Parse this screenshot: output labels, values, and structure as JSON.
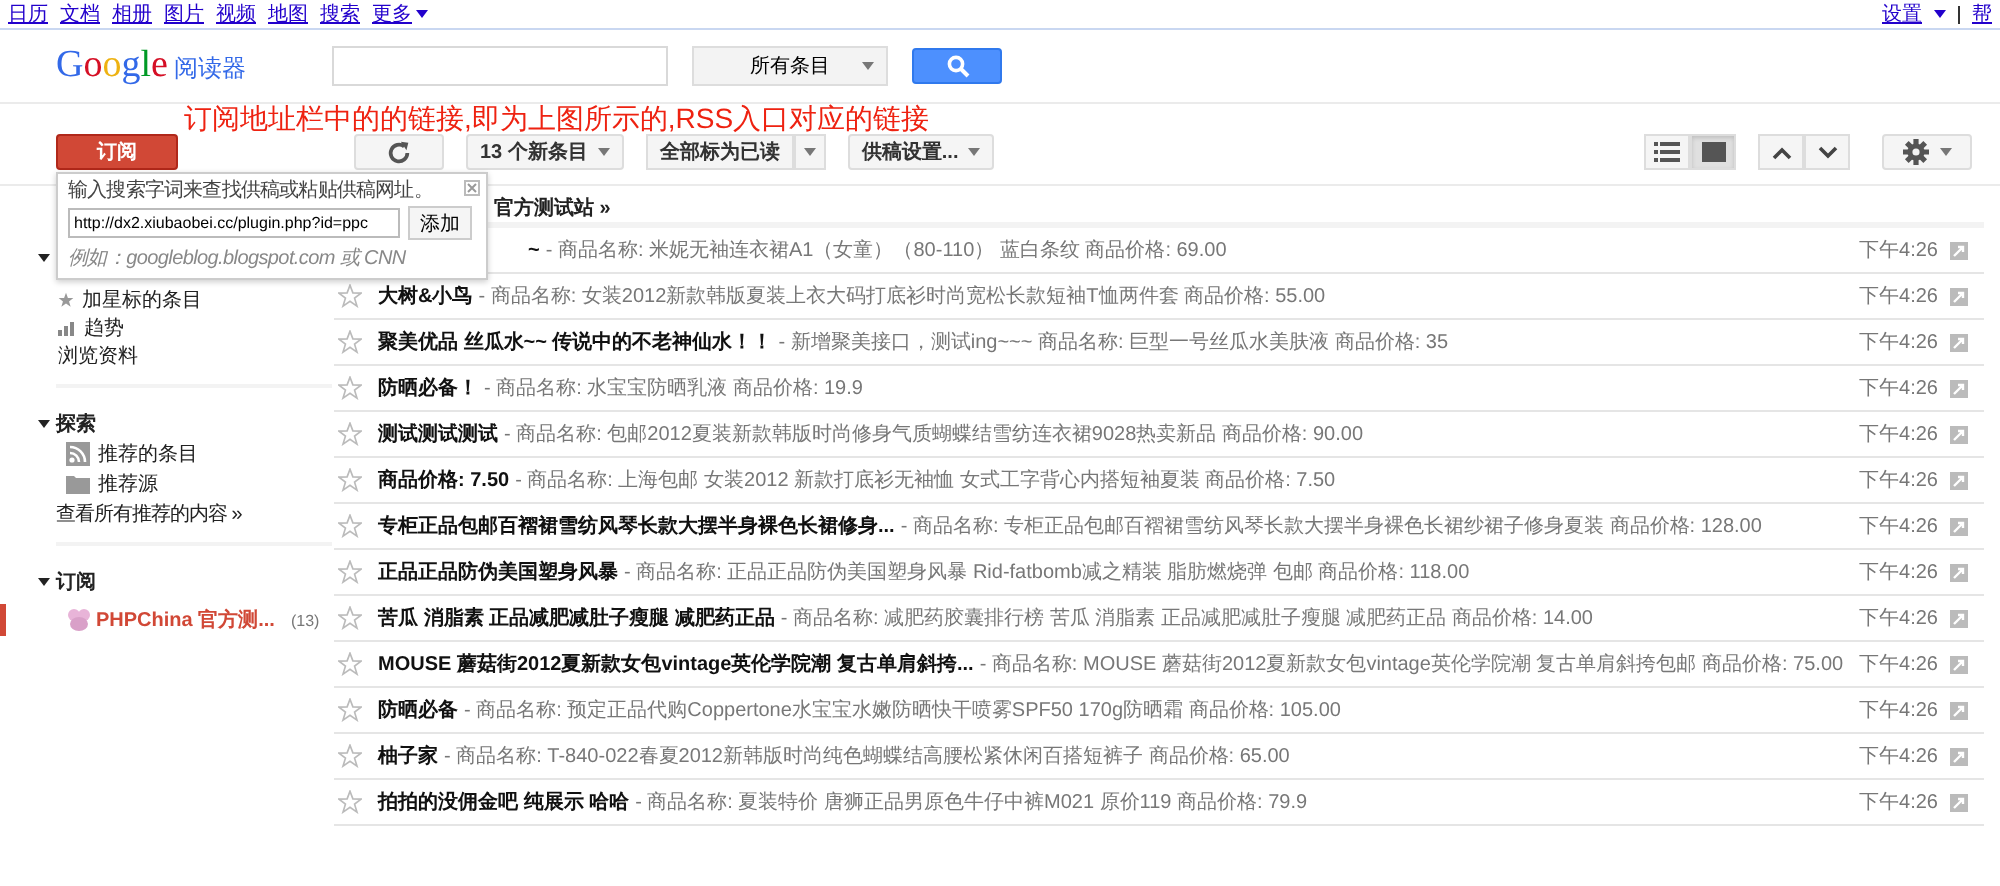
{
  "top_links": [
    "日历",
    "文档",
    "相册",
    "图片",
    "视频",
    "地图",
    "搜索",
    "更多"
  ],
  "top_right": {
    "settings": "设置",
    "help": "帮"
  },
  "logo": {
    "brand": "Google",
    "product": "阅读器"
  },
  "search": {
    "scope": "所有条目"
  },
  "annotation": "订阅地址栏中的的链接,即为上图所示的,RSS入口对应的链接",
  "toolbar": {
    "subscribe": "订阅",
    "new_items": "13 个新条目",
    "mark_all": "全部标为已读",
    "feed_settings": "供稿设置...",
    "views": [
      {
        "kind": "list",
        "selected": false
      },
      {
        "kind": "expanded",
        "selected": true
      }
    ]
  },
  "subscribe_popup": {
    "open": true,
    "hint": "输入搜索字词来查找供稿或粘贴供稿网址。",
    "url": "http://dx2.xiubaobei.cc/plugin.php?id=ppc",
    "add": "添加",
    "example": "例如：googleblog.blogspot.com 或 CNN"
  },
  "sidebar": {
    "items": [
      {
        "kind": "star",
        "label": "加星标的条目"
      },
      {
        "kind": "trends",
        "label": "趋势"
      },
      {
        "kind": "plain",
        "label": "浏览资料"
      }
    ],
    "explore": {
      "title": "探索",
      "expanded": true,
      "items": [
        {
          "kind": "rss",
          "label": "推荐的条目"
        },
        {
          "kind": "folder",
          "label": "推荐源"
        }
      ],
      "more": "查看所有推荐的内容 »"
    },
    "subscriptions": {
      "title": "订阅",
      "expanded": true,
      "items": [
        {
          "label": "PHPChina 官方测...",
          "count": "(13)",
          "selected": true
        }
      ]
    }
  },
  "feed_title": "官方测试站 »",
  "rows": [
    {
      "title": "~",
      "snippet": "- 商品名称: 米妮无袖连衣裙A1（女童）（80-110） 蓝白条纹 商品价格: 69.00",
      "time": "下午4:26"
    },
    {
      "title": "大树&小鸟",
      "snippet": "- 商品名称: 女装2012新款韩版夏装上衣大码打底衫时尚宽松长款短袖T恤两件套 商品价格: 55.00",
      "time": "下午4:26",
      "starred": false
    },
    {
      "title": "聚美优品 丝瓜水~~ 传说中的不老神仙水！！",
      "snippet": "- 新增聚美接口，测试ing~~~ 商品名称: 巨型一号丝瓜水美肤液 商品价格: 35",
      "time": "下午4:26",
      "starred": false
    },
    {
      "title": "防晒必备！",
      "snippet": "- 商品名称: 水宝宝防晒乳液 商品价格: 19.9",
      "time": "下午4:26",
      "starred": false
    },
    {
      "title": "测试测试测试",
      "snippet": "- 商品名称: 包邮2012夏装新款韩版时尚修身气质蝴蝶结雪纺连衣裙9028热卖新品 商品价格: 90.00",
      "time": "下午4:26",
      "starred": false
    },
    {
      "title": "商品价格: 7.50",
      "snippet": "- 商品名称: 上海包邮 女装2012 新款打底衫无袖恤 女式工字背心内搭短袖夏装 商品价格: 7.50",
      "time": "下午4:26",
      "starred": false
    },
    {
      "title": "专柜正品包邮百褶裙雪纺风琴长款大摆半身裸色长裙修身...",
      "snippet": "- 商品名称: 专柜正品包邮百褶裙雪纺风琴长款大摆半身裸色长裙纱裙子修身夏装 商品价格: 128.00",
      "time": "下午4:26",
      "starred": false
    },
    {
      "title": "正品正品防伪美国塑身风暴",
      "snippet": "- 商品名称: 正品正品防伪美国塑身风暴 Rid-fatbomb减之精装 脂肪燃烧弹 包邮 商品价格: 118.00",
      "time": "下午4:26",
      "starred": false
    },
    {
      "title": "苦瓜 消脂素 正品减肥减肚子瘦腿 减肥药正品",
      "snippet": "- 商品名称: 减肥药胶囊排行榜 苦瓜 消脂素 正品减肥减肚子瘦腿 减肥药正品 商品价格: 14.00",
      "time": "下午4:26",
      "starred": false
    },
    {
      "title": "MOUSE 蘑菇街2012夏新款女包vintage英伦学院潮 复古单肩斜挎...",
      "snippet": "- 商品名称: MOUSE 蘑菇街2012夏新款女包vintage英伦学院潮 复古单肩斜挎包邮 商品价格: 75.00",
      "time": "下午4:26",
      "starred": false
    },
    {
      "title": "防晒必备",
      "snippet": "- 商品名称: 预定正品代购Coppertone水宝宝水嫩防晒快干喷雾SPF50 170g防晒霜 商品价格: 105.00",
      "time": "下午4:26",
      "starred": false
    },
    {
      "title": "柚子家",
      "snippet": "- 商品名称: T-840-022春夏2012新韩版时尚纯色蝴蝶结高腰松紧休闲百搭短裤子 商品价格: 65.00",
      "time": "下午4:26",
      "starred": false
    },
    {
      "title": "拍拍的没佣金吧 纯展示 哈哈",
      "snippet": "- 商品名称: 夏装特价 唐狮正品男原色牛仔中裤M021 原价119 商品价格: 79.9",
      "time": "下午4:26",
      "starred": false
    }
  ]
}
